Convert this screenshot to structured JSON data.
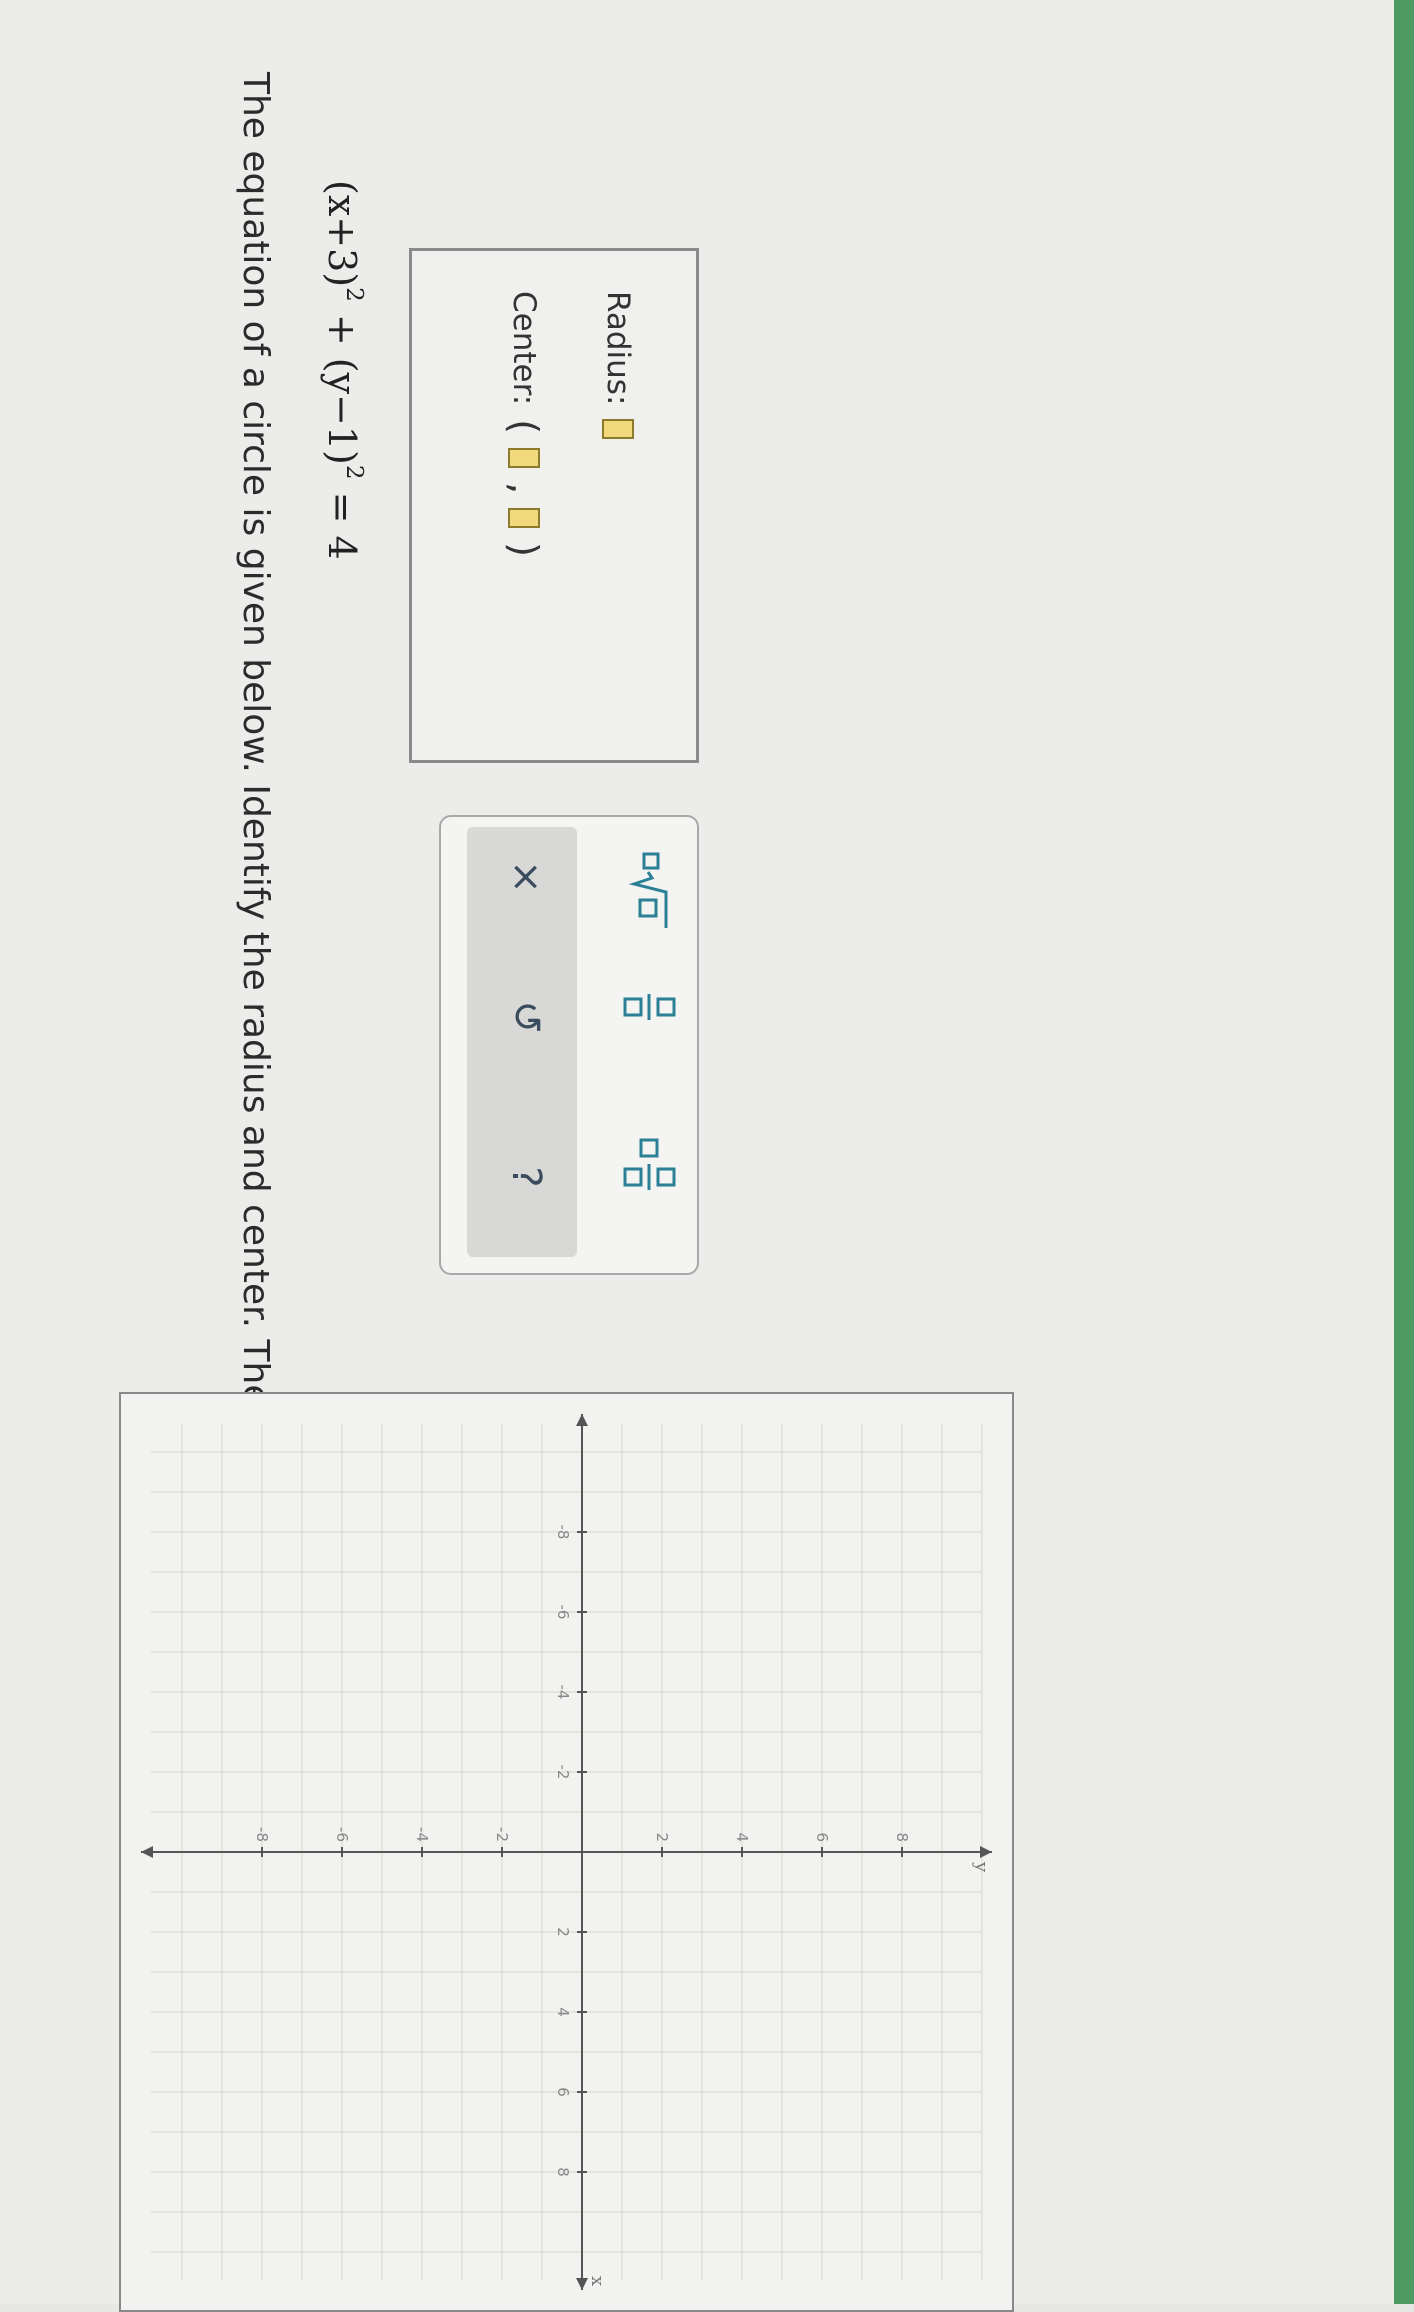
{
  "prompt": "The equation of a circle is given below. Identify the radius and center. Then graph the circle.",
  "equation": {
    "x_part": "(x+3)",
    "x_exp": "2",
    "plus": " + ",
    "y_part": "(y−1)",
    "y_exp": "2",
    "rhs": " = 4"
  },
  "answer": {
    "radius_label": "Radius:",
    "center_label": "Center:",
    "open_paren": "(",
    "comma": ",",
    "close_paren": ")"
  },
  "actions": {
    "clear": "×",
    "undo": "↺",
    "help": "?"
  },
  "graph": {
    "x_axis_label": "x",
    "y_axis_label": "y",
    "x_tick_labels": [
      "-8",
      "-6",
      "-4",
      "-2",
      "2",
      "4",
      "6",
      "8"
    ],
    "y_tick_labels": [
      "-8",
      "-6",
      "-4",
      "-2",
      "2",
      "4",
      "6",
      "8"
    ]
  },
  "colors": {
    "accent_green": "#4d9a63",
    "tool_teal": "#2b8096",
    "slot_yellow": "#f3d97e"
  }
}
